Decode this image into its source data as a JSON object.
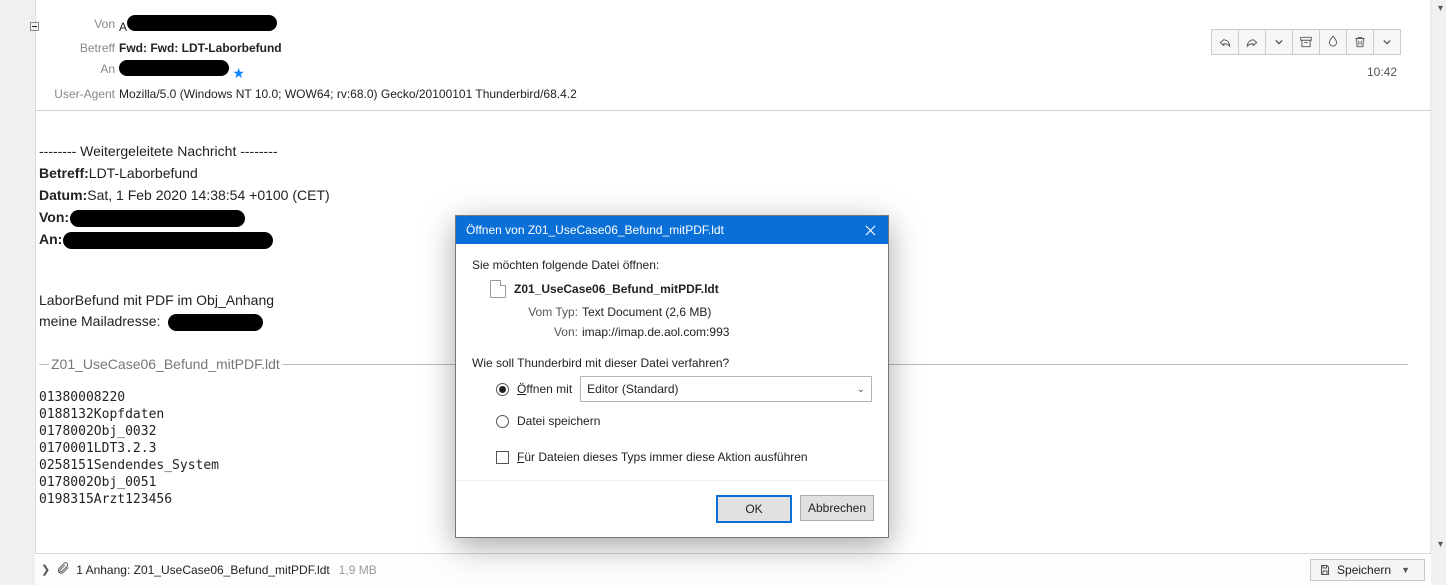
{
  "header": {
    "labels": {
      "from": "Von",
      "subject": "Betreff",
      "to": "An",
      "user_agent": "User-Agent"
    },
    "subject": "Fwd: Fwd: LDT-Laborbefund",
    "user_agent": "Mozilla/5.0 (Windows NT 10.0; WOW64; rv:68.0) Gecko/20100101 Thunderbird/68.4.2",
    "from_visible_prefix": "A",
    "time": "10:42"
  },
  "body": {
    "fwd_divider": "-------- Weitergeleitete Nachricht --------",
    "fields": {
      "subject_label": "Betreff:",
      "subject": "LDT-Laborbefund",
      "date_label": "Datum:",
      "date": "Sat, 1 Feb 2020 14:38:54 +0100 (CET)",
      "from_label": "Von:",
      "to_label": "An:"
    },
    "line1": "LaborBefund mit PDF im Obj_Anhang",
    "line2_prefix": "meine Mailadresse: ",
    "attachment_inline_name": "Z01_UseCase06_Befund_mitPDF.ldt",
    "ldt_lines": [
      "01380008220",
      "0188132Kopfdaten",
      "0178002Obj_0032",
      "0170001LDT3.2.3",
      "0258151Sendendes_System",
      "0178002Obj_0051",
      "0198315Arzt123456"
    ]
  },
  "footer": {
    "count_label": "1 Anhang:",
    "filename": "Z01_UseCase06_Befund_mitPDF.ldt",
    "size": "1,9 MB",
    "save": "Speichern"
  },
  "dialog": {
    "title": "Öffnen von Z01_UseCase06_Befund_mitPDF.ldt",
    "intro": "Sie möchten folgende Datei öffnen:",
    "filename": "Z01_UseCase06_Befund_mitPDF.ldt",
    "type_label": "Vom Typ:",
    "type": "Text Document (2,6 MB)",
    "from_label": "Von:",
    "from": "imap://imap.de.aol.com:993",
    "question": "Wie soll Thunderbird mit dieser Datei verfahren?",
    "open_with": "Öffnen mit",
    "open_app": "Editor (Standard)",
    "save_file": "Datei speichern",
    "always": "Für Dateien dieses Typs immer diese Aktion ausführen",
    "ok": "OK",
    "cancel": "Abbrechen"
  }
}
